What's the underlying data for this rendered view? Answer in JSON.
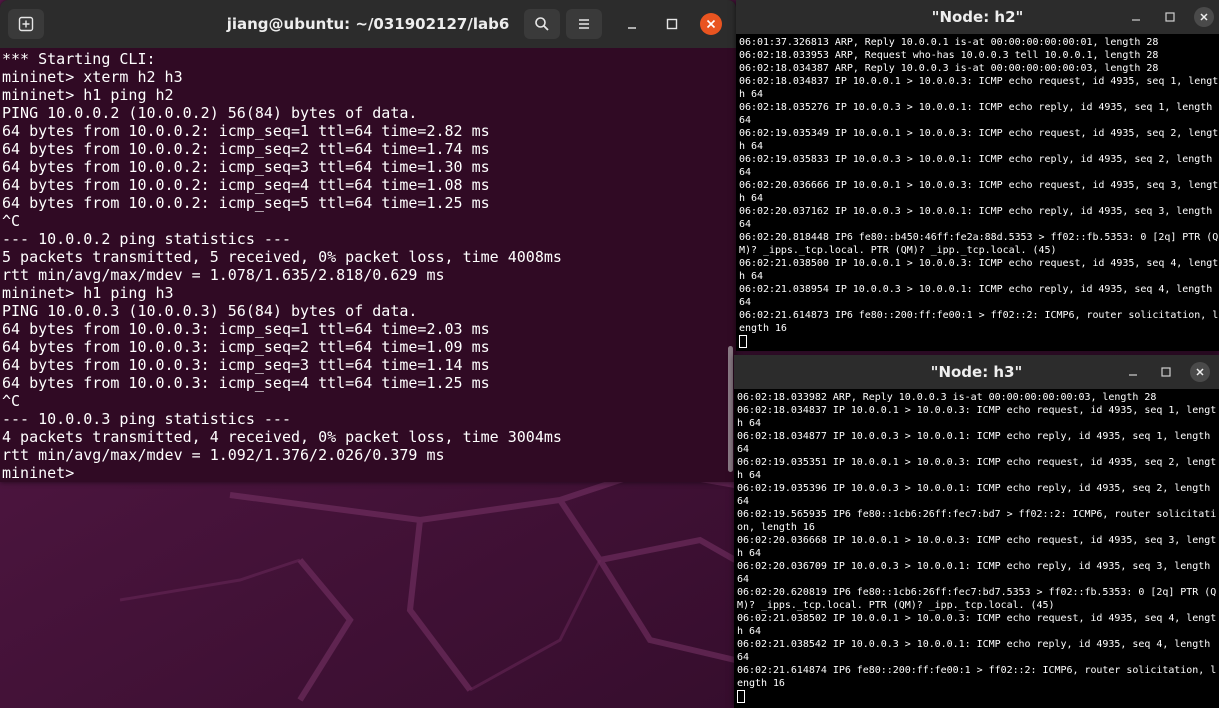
{
  "main_terminal": {
    "title": "jiang@ubuntu: ~/031902127/lab6",
    "lines": [
      "*** Starting CLI:",
      "mininet> xterm h2 h3",
      "mininet> h1 ping h2",
      "PING 10.0.0.2 (10.0.0.2) 56(84) bytes of data.",
      "64 bytes from 10.0.0.2: icmp_seq=1 ttl=64 time=2.82 ms",
      "64 bytes from 10.0.0.2: icmp_seq=2 ttl=64 time=1.74 ms",
      "64 bytes from 10.0.0.2: icmp_seq=3 ttl=64 time=1.30 ms",
      "64 bytes from 10.0.0.2: icmp_seq=4 ttl=64 time=1.08 ms",
      "64 bytes from 10.0.0.2: icmp_seq=5 ttl=64 time=1.25 ms",
      "^C",
      "--- 10.0.0.2 ping statistics ---",
      "5 packets transmitted, 5 received, 0% packet loss, time 4008ms",
      "rtt min/avg/max/mdev = 1.078/1.635/2.818/0.629 ms",
      "mininet> h1 ping h3",
      "PING 10.0.0.3 (10.0.0.3) 56(84) bytes of data.",
      "64 bytes from 10.0.0.3: icmp_seq=1 ttl=64 time=2.03 ms",
      "64 bytes from 10.0.0.3: icmp_seq=2 ttl=64 time=1.09 ms",
      "64 bytes from 10.0.0.3: icmp_seq=3 ttl=64 time=1.14 ms",
      "64 bytes from 10.0.0.3: icmp_seq=4 ttl=64 time=1.25 ms",
      "^C",
      "--- 10.0.0.3 ping statistics ---",
      "4 packets transmitted, 4 received, 0% packet loss, time 3004ms",
      "rtt min/avg/max/mdev = 1.092/1.376/2.026/0.379 ms",
      "mininet> "
    ]
  },
  "xterm_h2": {
    "title": "\"Node: h2\"",
    "lines": [
      "06:01:37.326813 ARP, Reply 10.0.0.1 is-at 00:00:00:00:00:01, length 28",
      "06:02:18.033953 ARP, Request who-has 10.0.0.3 tell 10.0.0.1, length 28",
      "06:02:18.034387 ARP, Reply 10.0.0.3 is-at 00:00:00:00:00:03, length 28",
      "06:02:18.034837 IP 10.0.0.1 > 10.0.0.3: ICMP echo request, id 4935, seq 1, lengt",
      "h 64",
      "06:02:18.035276 IP 10.0.0.3 > 10.0.0.1: ICMP echo reply, id 4935, seq 1, length",
      "64",
      "06:02:19.035349 IP 10.0.0.1 > 10.0.0.3: ICMP echo request, id 4935, seq 2, lengt",
      "h 64",
      "06:02:19.035833 IP 10.0.0.3 > 10.0.0.1: ICMP echo reply, id 4935, seq 2, length",
      "64",
      "06:02:20.036666 IP 10.0.0.1 > 10.0.0.3: ICMP echo request, id 4935, seq 3, lengt",
      "h 64",
      "06:02:20.037162 IP 10.0.0.3 > 10.0.0.1: ICMP echo reply, id 4935, seq 3, length",
      "64",
      "06:02:20.818448 IP6 fe80::b450:46ff:fe2a:88d.5353 > ff02::fb.5353: 0 [2q] PTR (Q",
      "M)? _ipps._tcp.local. PTR (QM)? _ipp._tcp.local. (45)",
      "06:02:21.038500 IP 10.0.0.1 > 10.0.0.3: ICMP echo request, id 4935, seq 4, lengt",
      "h 64",
      "06:02:21.038954 IP 10.0.0.3 > 10.0.0.1: ICMP echo reply, id 4935, seq 4, length",
      "64",
      "06:02:21.614873 IP6 fe80::200:ff:fe00:1 > ff02::2: ICMP6, router solicitation, l",
      "ength 16"
    ]
  },
  "xterm_h3": {
    "title": "\"Node: h3\"",
    "lines": [
      "06:02:18.033982 ARP, Reply 10.0.0.3 is-at 00:00:00:00:00:03, length 28",
      "06:02:18.034837 IP 10.0.0.1 > 10.0.0.3: ICMP echo request, id 4935, seq 1, lengt",
      "h 64",
      "06:02:18.034877 IP 10.0.0.3 > 10.0.0.1: ICMP echo reply, id 4935, seq 1, length",
      "64",
      "06:02:19.035351 IP 10.0.0.1 > 10.0.0.3: ICMP echo request, id 4935, seq 2, lengt",
      "h 64",
      "06:02:19.035396 IP 10.0.0.3 > 10.0.0.1: ICMP echo reply, id 4935, seq 2, length",
      "64",
      "06:02:19.565935 IP6 fe80::1cb6:26ff:fec7:bd7 > ff02::2: ICMP6, router solicitati",
      "on, length 16",
      "06:02:20.036668 IP 10.0.0.1 > 10.0.0.3: ICMP echo request, id 4935, seq 3, lengt",
      "h 64",
      "06:02:20.036709 IP 10.0.0.3 > 10.0.0.1: ICMP echo reply, id 4935, seq 3, length",
      "64",
      "06:02:20.620819 IP6 fe80::1cb6:26ff:fec7:bd7.5353 > ff02::fb.5353: 0 [2q] PTR (Q",
      "M)? _ipps._tcp.local. PTR (QM)? _ipp._tcp.local. (45)",
      "06:02:21.038502 IP 10.0.0.1 > 10.0.0.3: ICMP echo request, id 4935, seq 4, lengt",
      "h 64",
      "06:02:21.038542 IP 10.0.0.3 > 10.0.0.1: ICMP echo reply, id 4935, seq 4, length",
      "64",
      "06:02:21.614874 IP6 fe80::200:ff:fe00:1 > ff02::2: ICMP6, router solicitation, l",
      "ength 16"
    ]
  },
  "icons": {
    "new_tab": "new-tab-icon",
    "search": "search-icon",
    "menu": "hamburger-menu-icon",
    "minimize": "minimize-icon",
    "maximize": "maximize-icon",
    "close": "close-icon"
  },
  "colors": {
    "terminal_bg": "#300a24",
    "header_bg": "#2c2c2c",
    "close_accent": "#e95420",
    "wallpaper": "#3b0d2e"
  }
}
